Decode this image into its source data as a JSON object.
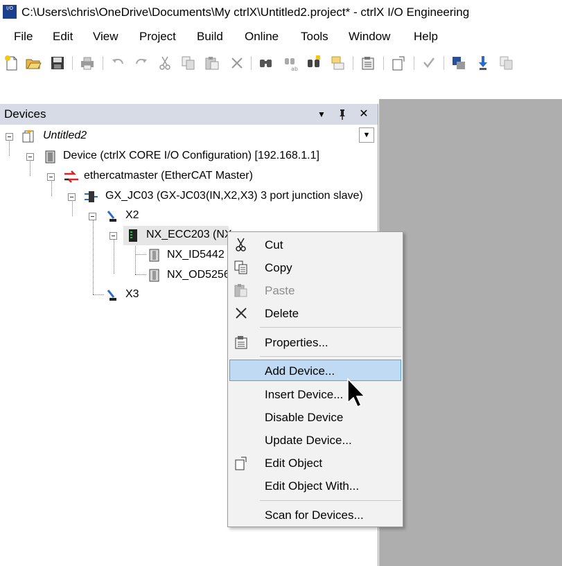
{
  "window": {
    "title": "C:\\Users\\chris\\OneDrive\\Documents\\My ctrlX\\Untitled2.project* - ctrlX I/O Engineering",
    "app_icon_text": "I/O"
  },
  "menu": [
    "File",
    "Edit",
    "View",
    "Project",
    "Build",
    "Online",
    "Tools",
    "Window",
    "Help"
  ],
  "toolbar": {
    "icons": [
      "new-project-icon",
      "open-folder-icon",
      "save-icon",
      "print-icon",
      "undo-icon",
      "redo-icon",
      "cut-icon",
      "copy-icon",
      "paste-icon",
      "delete-icon",
      "find-icon",
      "find-replace-icon",
      "find-next-icon",
      "replace-icon",
      "properties-icon",
      "edit-object-icon",
      "bookmark-icon",
      "login-icon",
      "download-icon",
      "copy-device-icon"
    ]
  },
  "devices_panel": {
    "title": "Devices",
    "header_buttons": {
      "dropdown": "▼",
      "pin": "📌",
      "close": "✕"
    },
    "tree": [
      {
        "label": "Untitled2",
        "italic": true,
        "icon": "project-icon"
      },
      {
        "label": "Device (ctrlX CORE I/O Configuration) [192.168.1.1]",
        "icon": "device-icon"
      },
      {
        "label": "ethercatmaster (EtherCAT Master)",
        "icon": "ethercat-master-icon"
      },
      {
        "label": "GX_JC03 (GX-JC03(IN,X2,X3) 3 port junction slave)",
        "icon": "junction-icon"
      },
      {
        "label": "X2",
        "icon": "port-icon"
      },
      {
        "label": "NX_ECC203 (NX",
        "icon": "coupler-icon"
      },
      {
        "label": "NX_ID5442",
        "icon": "module-icon"
      },
      {
        "label": "NX_OD5256",
        "icon": "module-icon"
      },
      {
        "label": "X3",
        "icon": "port-icon"
      }
    ]
  },
  "context_menu": {
    "items": [
      {
        "label": "Cut",
        "icon": "scissors-icon",
        "enabled": true
      },
      {
        "label": "Copy",
        "icon": "copy-icon",
        "enabled": true
      },
      {
        "label": "Paste",
        "icon": "paste-icon",
        "enabled": false
      },
      {
        "label": "Delete",
        "icon": "delete-icon",
        "enabled": true
      },
      {
        "label": "Properties...",
        "icon": "properties-icon",
        "enabled": true
      },
      {
        "label": "Add Device...",
        "icon": "",
        "enabled": true,
        "highlighted": true
      },
      {
        "label": "Insert Device...",
        "icon": "",
        "enabled": true
      },
      {
        "label": "Disable Device",
        "icon": "",
        "enabled": true
      },
      {
        "label": "Update Device...",
        "icon": "",
        "enabled": true
      },
      {
        "label": "Edit Object",
        "icon": "edit-object-icon",
        "enabled": true
      },
      {
        "label": "Edit Object With...",
        "icon": "",
        "enabled": true
      },
      {
        "label": "Scan for Devices...",
        "icon": "",
        "enabled": true
      }
    ]
  },
  "colors": {
    "panel_header": "#d6dbe6",
    "right_area": "#aeaeae",
    "menu_bg": "#f2f2f2",
    "highlight": "#bfdaf2",
    "highlight_border": "#5d9fd8"
  }
}
